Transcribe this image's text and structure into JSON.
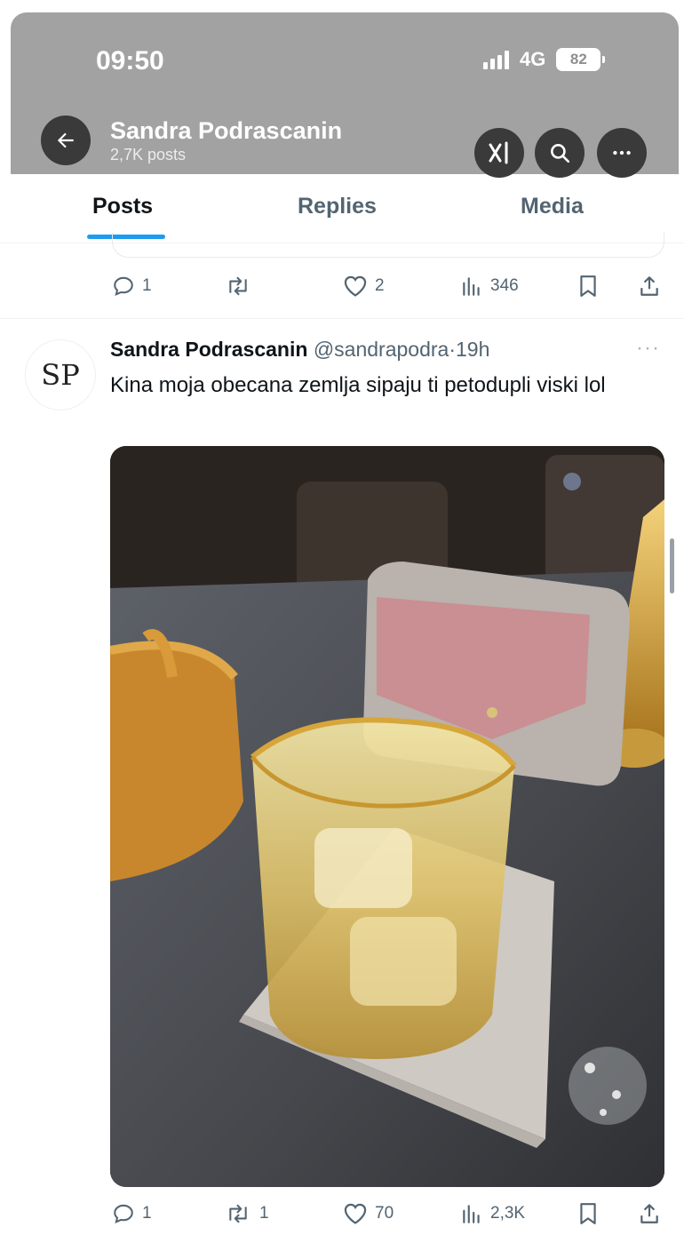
{
  "status_bar": {
    "time": "09:50",
    "network": "4G",
    "battery": "82"
  },
  "header": {
    "title": "Sandra Podrascanin",
    "subtitle": "2,7K posts"
  },
  "tabs": [
    {
      "label": "Posts",
      "active": true
    },
    {
      "label": "Replies",
      "active": false
    },
    {
      "label": "Media",
      "active": false
    }
  ],
  "previous_post": {
    "actions": {
      "replies": "1",
      "reposts": "",
      "likes": "2",
      "views": "346"
    }
  },
  "post": {
    "avatar_initials": "SP",
    "author_name": "Sandra Podrascanin",
    "author_handle": "@sandrapodra",
    "separator": "·",
    "time": "19h",
    "more": "···",
    "text": "Kina moja obecana zemlja sipaju ti petodupli viski lol",
    "image_description_icon": "photo-whisky-glass",
    "actions": {
      "replies": "1",
      "reposts": "1",
      "likes": "70",
      "views": "2,3K"
    }
  },
  "colors": {
    "accent": "#1d9bf0",
    "header_bg": "#a2a2a2",
    "muted": "#536471"
  }
}
